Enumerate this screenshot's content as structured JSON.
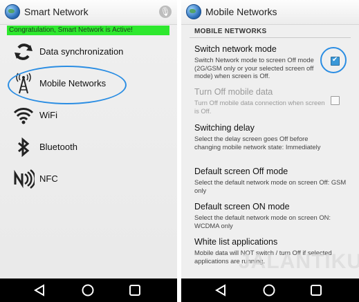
{
  "left": {
    "app_title": "Smart Network",
    "banner_text": "Congratulation, Smart Network is Active!",
    "menu": [
      {
        "label": "Data synchronization",
        "icon": "sync-icon"
      },
      {
        "label": "Mobile Networks",
        "icon": "antenna-icon"
      },
      {
        "label": "WiFi",
        "icon": "wifi-icon"
      },
      {
        "label": "Bluetooth",
        "icon": "bluetooth-icon"
      },
      {
        "label": "NFC",
        "icon": "nfc-icon"
      }
    ]
  },
  "right": {
    "app_title": "Mobile Networks",
    "section_header": "MOBILE NETWORKS",
    "settings": [
      {
        "title": "Switch network mode",
        "desc": "Switch Network mode to screen Off mode (2G/GSM only or your selected screen off mode) when screen is Off.",
        "checked": true,
        "disabled": false
      },
      {
        "title": "Turn Off mobile data",
        "desc": "Turn Off mobile data connection when screen is Off.",
        "checked": false,
        "disabled": true
      },
      {
        "title": "Switching delay",
        "desc": "Select the delay screen goes Off before changing mobile network state: Immediately"
      },
      {
        "title": "Default screen Off mode",
        "desc": "Select the default network mode on screen Off: GSM only"
      },
      {
        "title": "Default screen ON mode",
        "desc": "Select the default network mode on screen ON: WCDMA only"
      },
      {
        "title": "White list applications",
        "desc": "Mobile data will NOT switch / turn Off if selected applications are running."
      }
    ],
    "watermark": "JALANTIKUS"
  },
  "colors": {
    "banner_green": "#2ee82e",
    "highlight_blue": "#2a8de3",
    "nav_black": "#000000"
  }
}
